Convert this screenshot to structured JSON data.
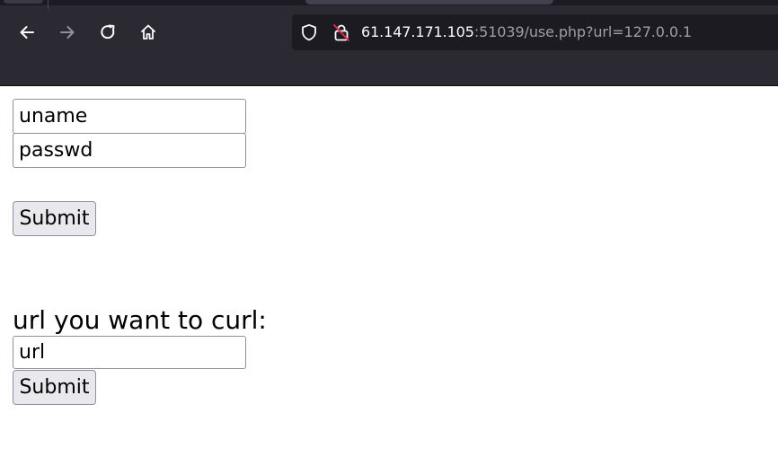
{
  "browser": {
    "icons": {
      "back": "arrow-left-icon",
      "forward": "arrow-right-icon",
      "reload": "reload-icon",
      "home": "home-icon",
      "shield": "shield-icon",
      "insecure_lock": "insecure-lock-icon"
    },
    "address_bar": {
      "host": "61.147.171.105",
      "rest": ":51039/use.php?url=127.0.0.1"
    },
    "colors": {
      "chrome_bg": "#2b2a33",
      "urlbar_bg": "#1c1b22",
      "icon": "#fbfbfe",
      "icon_disabled": "#8f8f9d",
      "insecure_slash": "#e22850"
    }
  },
  "page": {
    "login_form": {
      "username_placeholder": "uname",
      "password_placeholder": "passwd",
      "submit_label": "Submit"
    },
    "curl_form": {
      "label": "url you want to curl:",
      "url_placeholder": "url",
      "submit_label": "Submit"
    }
  }
}
